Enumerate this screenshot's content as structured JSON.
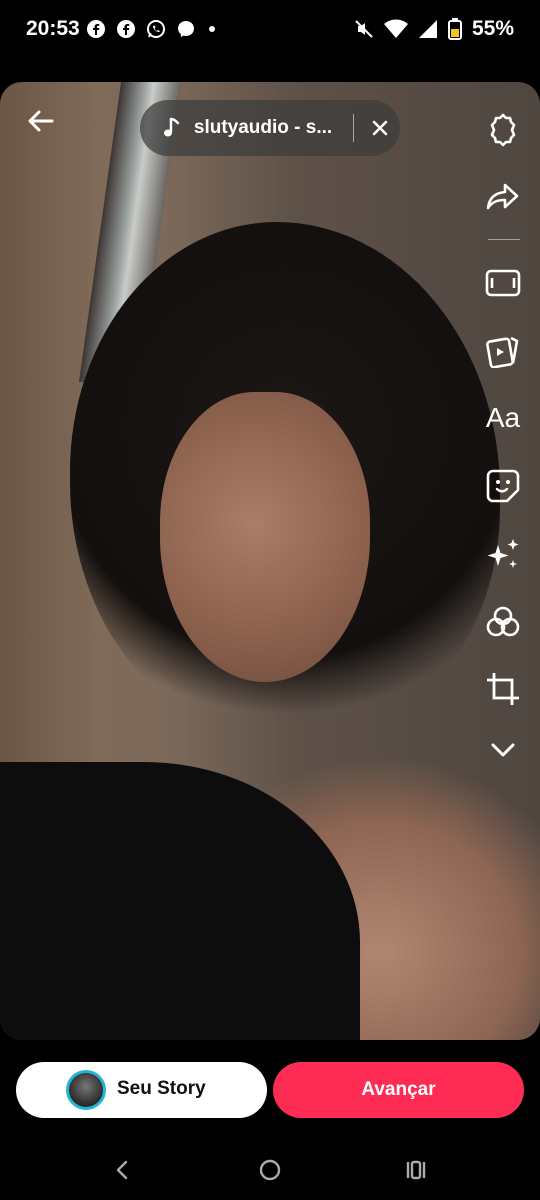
{
  "status_bar": {
    "time": "20:53",
    "battery_percent": "55%",
    "notification_icons": [
      "facebook-icon",
      "facebook-icon",
      "whatsapp-icon",
      "messenger-icon",
      "dot-icon"
    ],
    "system_icons": [
      "mute-icon",
      "wifi-icon",
      "signal-icon",
      "battery-icon"
    ]
  },
  "music": {
    "title": "slutyaudio - s..."
  },
  "toolbar": {
    "items": [
      "settings-icon",
      "share-icon",
      "format-icon",
      "templates-icon",
      "text-icon",
      "sticker-icon",
      "effects-icon",
      "filters-icon",
      "crop-icon",
      "more-icon"
    ],
    "text_tool_label": "Aa"
  },
  "bottom": {
    "story_label": "Seu Story",
    "next_label": "Avançar"
  },
  "colors": {
    "accent": "#fe2c55",
    "avatar_ring": "#22b6d6"
  }
}
